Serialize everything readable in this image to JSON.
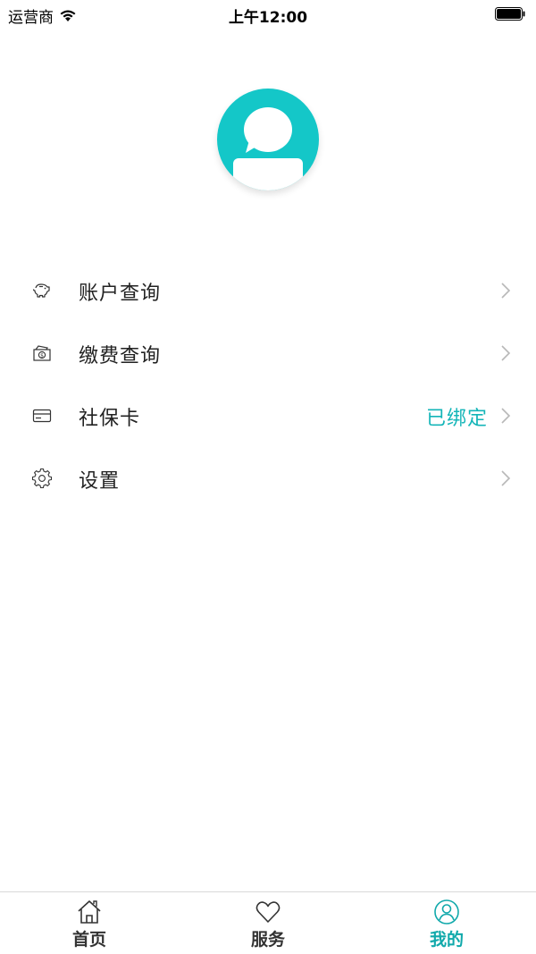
{
  "status_bar": {
    "carrier": "运营商",
    "time": "上午12:00",
    "icons": [
      "wifi-icon",
      "battery-icon"
    ]
  },
  "profile": {
    "avatar_icon": "avatar-chat-bubble-icon",
    "accent_color": "#14c7c8"
  },
  "menu": {
    "items": [
      {
        "icon": "piggy-bank-icon",
        "label": "账户查询",
        "value": ""
      },
      {
        "icon": "payment-bill-icon",
        "label": "缴费查询",
        "value": ""
      },
      {
        "icon": "card-icon",
        "label": "社保卡",
        "value": "已绑定"
      },
      {
        "icon": "gear-icon",
        "label": "设置",
        "value": ""
      }
    ],
    "value_color": "#14b5b8"
  },
  "tab_bar": {
    "tabs": [
      {
        "icon": "home-icon",
        "label": "首页",
        "active": false
      },
      {
        "icon": "heart-icon",
        "label": "服务",
        "active": false
      },
      {
        "icon": "user-icon",
        "label": "我的",
        "active": true
      }
    ],
    "active_color": "#11a9ab"
  }
}
